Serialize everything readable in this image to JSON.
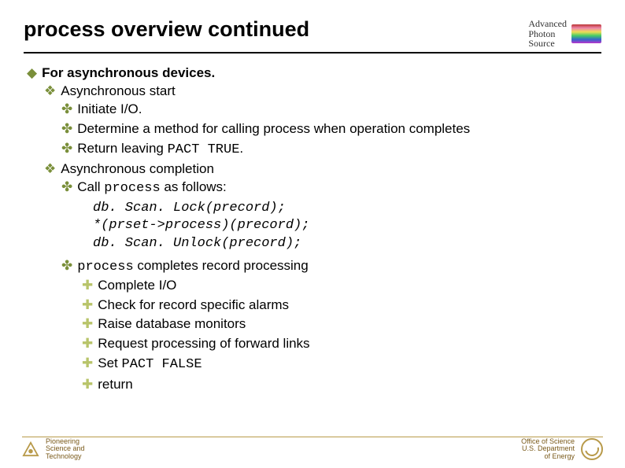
{
  "title": "process overview continued",
  "aps_logo_line1": "Advanced",
  "aps_logo_line2": "Photon",
  "aps_logo_line3": "Source",
  "l1": "For asynchronous devices.",
  "l2a": "Asynchronous start",
  "l3a1": "Initiate I/O.",
  "l3a2": "Determine a method for calling process when operation completes",
  "l3a3_pre": "Return leaving ",
  "l3a3_code": "PACT TRUE",
  "l3a3_post": ".",
  "l2b": "Asynchronous completion",
  "l3b1_pre": "Call ",
  "l3b1_code": "process",
  "l3b1_post": " as follows:",
  "code1": "db. Scan. Lock(precord);",
  "code2": "*(prset->process)(precord);",
  "code3": "db. Scan. Unlock(precord);",
  "l3b2_code": "process",
  "l3b2_post": " completes record processing",
  "l4c1": "Complete I/O",
  "l4c2": "Check for record specific alarms",
  "l4c3": "Raise database monitors",
  "l4c4": "Request processing of forward links",
  "l4c5_pre": "Set ",
  "l4c5_code": "PACT FALSE",
  "l4c6": "return",
  "footer_left_l1": "Pioneering",
  "footer_left_l2": "Science and",
  "footer_left_l3": "Technology",
  "footer_right_l1": "Office of Science",
  "footer_right_l2": "U.S. Department",
  "footer_right_l3": "of Energy"
}
